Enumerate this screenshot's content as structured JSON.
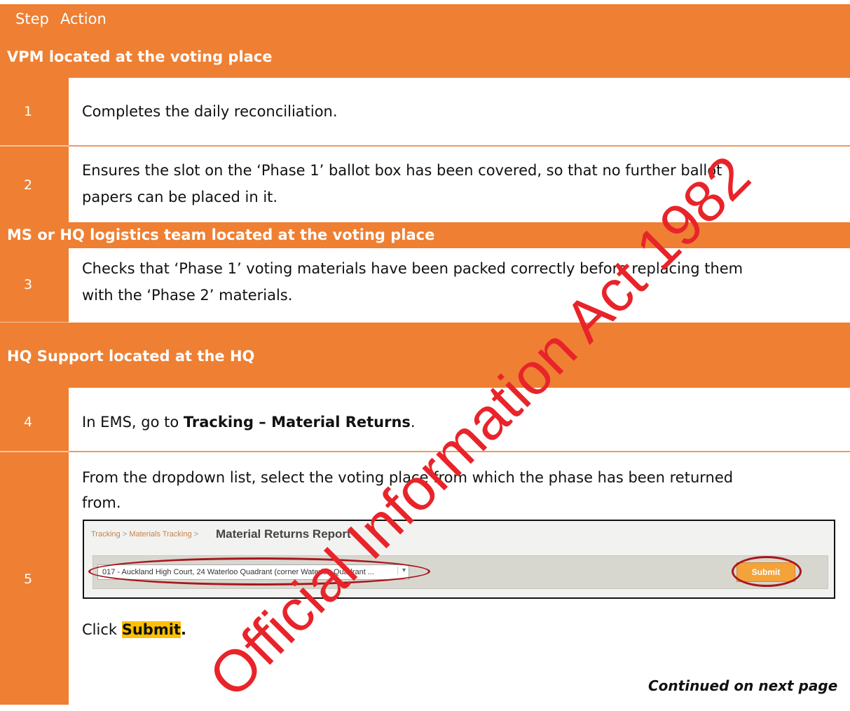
{
  "header": {
    "step_label": "Step",
    "action_label": "Action"
  },
  "sections": {
    "s1": "VPM located at the voting place",
    "s2": "MS or HQ logistics team located at the voting place",
    "s3": "HQ Support located at the HQ"
  },
  "steps": {
    "st1": {
      "number": "1",
      "line1": "Completes the daily reconciliation."
    },
    "st2": {
      "number": "2",
      "line1": "Ensures the slot on the ‘Phase 1’ ballot box has been covered, so that no further ballot",
      "line2": "papers can be placed in it."
    },
    "st3": {
      "number": "3",
      "line1": "Checks that ‘Phase 1’ voting materials have been packed correctly before replacing them",
      "line2": "with the ‘Phase 2’ materials."
    },
    "st4": {
      "number": "4",
      "prefix": "In EMS, go to ",
      "bold": "Tracking – Material Returns",
      "suffix": "."
    },
    "st5": {
      "number": "5",
      "line1": "From the dropdown list, select the voting place from which the phase has been returned",
      "line2": "from.",
      "click_prefix": "Click ",
      "click_bold": "Submit",
      "click_suffix": "."
    }
  },
  "screenshot": {
    "crumb1": "Tracking",
    "crumb2": "Materials Tracking",
    "title": "Material Returns Report",
    "dropdown_value": "017 - Auckland High Court, 24 Waterloo Quadrant (corner Waterloo Quadrant ...",
    "submit_label": "Submit"
  },
  "watermark": "Official Information Act 1982",
  "footer": {
    "continued": "Continued on next page"
  },
  "colors": {
    "accent": "#ee7f33",
    "highlight": "#ffc000",
    "circle": "#a8161d"
  }
}
